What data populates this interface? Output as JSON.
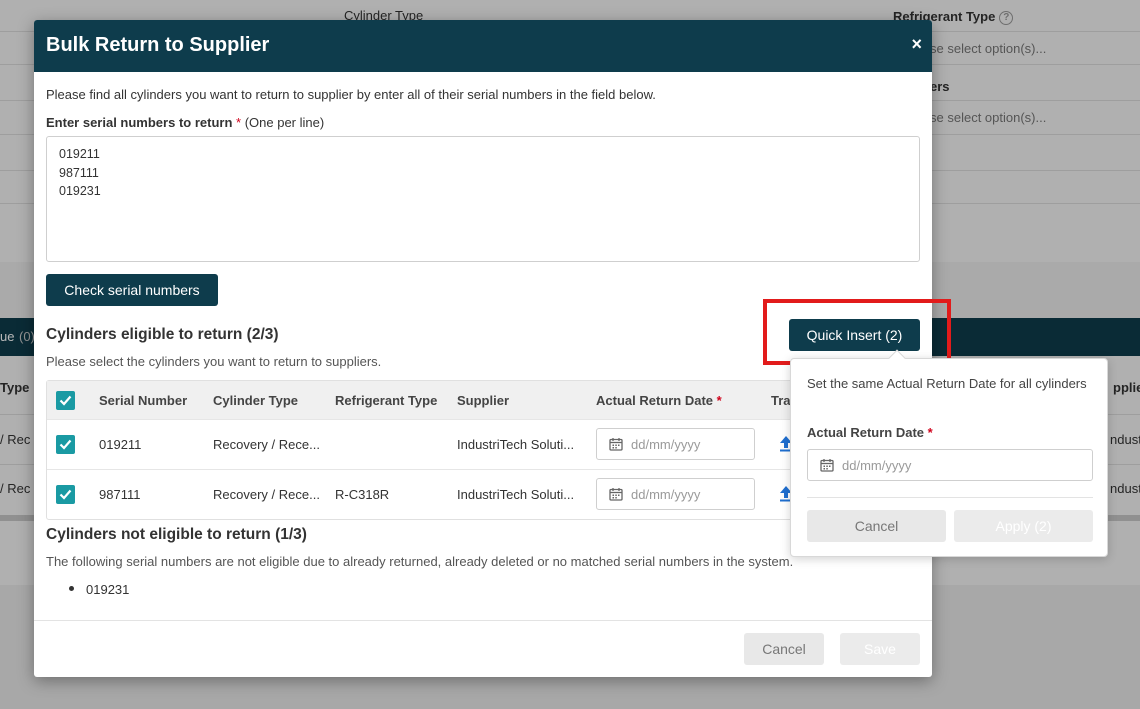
{
  "background": {
    "cylinder_type_label": "Cylinder Type",
    "refrigerant_type_label": "Refrigerant Type",
    "refrigerant_placeholder": "se select option(s)...",
    "suppliers_label_fragment": "ers",
    "suppliers_placeholder": "se select option(s)...",
    "bar_left_fragment": "ue",
    "bar_count_fragment": "(0)",
    "table_header_type_fragment": "Type",
    "table_header_supplier_fragment": "pplie",
    "row1_type_fragment": "/ Rec",
    "row1_supplier_fragment": "ndustr",
    "row2_type_fragment": "/ Rec",
    "row2_supplier_fragment": "ndustr"
  },
  "modal": {
    "title": "Bulk Return to Supplier",
    "close_symbol": "×",
    "instructions": "Please find all cylinders you want to return to supplier by enter all of their serial numbers in the field below.",
    "serial_label": "Enter serial numbers to return",
    "required_mark": "*",
    "serial_hint": "(One per line)",
    "serial_value": "019211\n987111\n019231",
    "check_button": "Check serial numbers",
    "eligible_title": "Cylinders eligible to return (2/3)",
    "eligible_subtitle": "Please select the cylinders you want to return to suppliers.",
    "quick_insert_button": "Quick Insert (2)",
    "table": {
      "headers": {
        "serial": "Serial Number",
        "cylinder_type": "Cylinder Type",
        "refrigerant_type": "Refrigerant Type",
        "supplier": "Supplier",
        "return_date": "Actual Return Date",
        "tracking": "Tra"
      },
      "rows": [
        {
          "serial": "019211",
          "cylinder_type": "Recovery / Rece...",
          "refrigerant_type": "",
          "supplier": "IndustriTech Soluti...",
          "date_placeholder": "dd/mm/yyyy",
          "checked": true
        },
        {
          "serial": "987111",
          "cylinder_type": "Recovery / Rece...",
          "refrigerant_type": "R-C318R",
          "supplier": "IndustriTech Soluti...",
          "date_placeholder": "dd/mm/yyyy",
          "checked": true
        }
      ]
    },
    "not_eligible_title": "Cylinders not eligible to return (1/3)",
    "not_eligible_desc": "The following serial numbers are not eligible due to already returned, already deleted or no matched serial numbers in the system.",
    "not_eligible_items": [
      "019231"
    ],
    "footer": {
      "cancel": "Cancel",
      "save": "Save"
    }
  },
  "popover": {
    "description": "Set the same Actual Return Date for all cylinders",
    "date_label": "Actual Return Date",
    "required_mark": "*",
    "date_placeholder": "dd/mm/yyyy",
    "cancel": "Cancel",
    "apply": "Apply (2)"
  },
  "colors": {
    "header_bg": "#0e3c4c",
    "checkbox": "#1a9aa3",
    "required": "#d0021b",
    "highlight": "#e21b1b"
  }
}
